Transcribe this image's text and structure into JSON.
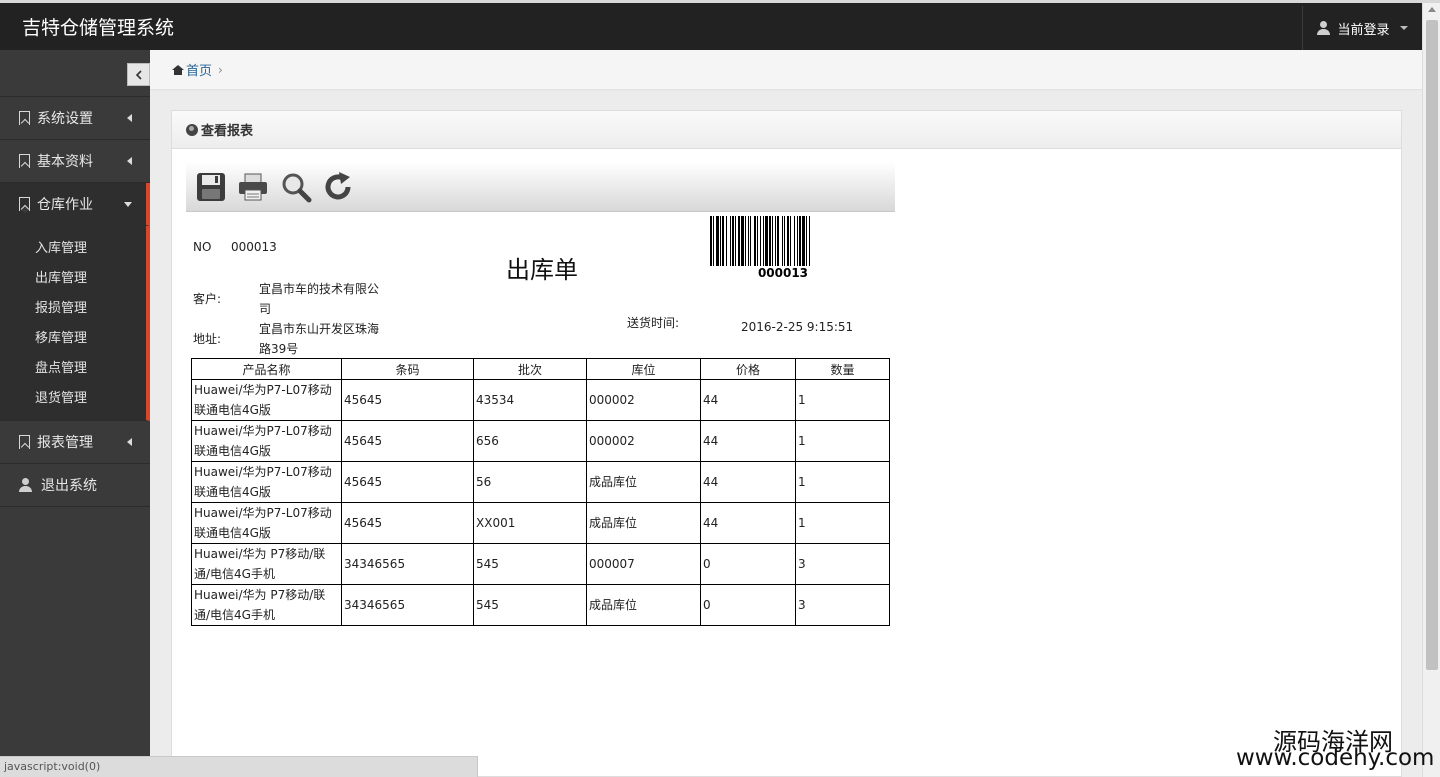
{
  "app": {
    "title": "吉特仓储管理系统",
    "user_menu": "当前登录"
  },
  "sidebar": {
    "collapse_icon": "chevron-left-icon",
    "items": [
      {
        "label": "系统设置",
        "icon": "bookmark-icon"
      },
      {
        "label": "基本资料",
        "icon": "bookmark-icon"
      },
      {
        "label": "仓库作业",
        "icon": "bookmark-icon"
      },
      {
        "label": "报表管理",
        "icon": "bookmark-icon"
      },
      {
        "label": "退出系统",
        "icon": "user-icon"
      }
    ],
    "submenu": [
      "入库管理",
      "出库管理",
      "报损管理",
      "移库管理",
      "盘点管理",
      "退货管理"
    ]
  },
  "breadcrumb": {
    "home": "首页",
    "separator": "›"
  },
  "panel": {
    "title": "查看报表"
  },
  "report": {
    "toolbar": [
      "save-icon",
      "print-icon",
      "search-icon",
      "refresh-icon"
    ],
    "no_label": "NO",
    "no_value": "000013",
    "title": "出库单",
    "barcode_value": "000013",
    "customer_label": "客户:",
    "customer_line1": "宜昌市车的技术有限公",
    "customer_line2": "司",
    "address_label": "地址:",
    "address_line1": "宜昌市东山开发区珠海",
    "address_line2": "路39号",
    "delivery_label": "送货时间:",
    "delivery_value": "2016-2-25 9:15:51",
    "columns": [
      "产品名称",
      "条码",
      "批次",
      "库位",
      "价格",
      "数量"
    ],
    "rows": [
      {
        "name1": "Huawei/华为P7-L07移动",
        "name2": "联通电信4G版",
        "barcode": "45645",
        "batch": "43534",
        "location": "000002",
        "price": "44",
        "qty": "1"
      },
      {
        "name1": "Huawei/华为P7-L07移动",
        "name2": "联通电信4G版",
        "barcode": "45645",
        "batch": "656",
        "location": "000002",
        "price": "44",
        "qty": "1"
      },
      {
        "name1": "Huawei/华为P7-L07移动",
        "name2": "联通电信4G版",
        "barcode": "45645",
        "batch": "56",
        "location": "成品库位",
        "price": "44",
        "qty": "1"
      },
      {
        "name1": "Huawei/华为P7-L07移动",
        "name2": "联通电信4G版",
        "barcode": "45645",
        "batch": "XX001",
        "location": "成品库位",
        "price": "44",
        "qty": "1"
      },
      {
        "name1": "Huawei/华为 P7移动/联",
        "name2": "通/电信4G手机",
        "barcode": "34346565",
        "batch": "545",
        "location": "000007",
        "price": "0",
        "qty": "3"
      },
      {
        "name1": "Huawei/华为 P7移动/联",
        "name2": "通/电信4G手机",
        "barcode": "34346565",
        "batch": "545",
        "location": "成品库位",
        "price": "0",
        "qty": "3"
      }
    ]
  },
  "status_bar": "javascript:void(0)",
  "watermark": {
    "cn": "源码海洋网",
    "url": "www.codehy.com"
  },
  "colors": {
    "accent": "#d9472b",
    "topbar": "#222222",
    "sidebar": "#3a3a3a"
  }
}
